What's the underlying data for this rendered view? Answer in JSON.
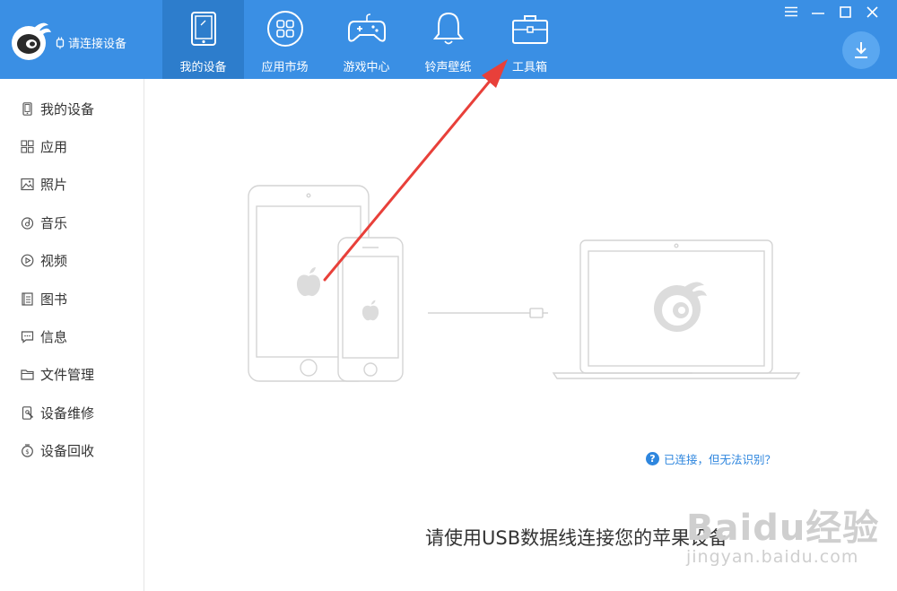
{
  "header": {
    "connection_status": "请连接设备",
    "tabs": [
      {
        "label": "我的设备",
        "icon": "tablet-icon",
        "active": true
      },
      {
        "label": "应用市场",
        "icon": "app-grid-icon",
        "active": false
      },
      {
        "label": "游戏中心",
        "icon": "gamepad-icon",
        "active": false
      },
      {
        "label": "铃声壁纸",
        "icon": "bell-icon",
        "active": false
      },
      {
        "label": "工具箱",
        "icon": "toolbox-icon",
        "active": false
      }
    ],
    "window_controls": [
      "menu-icon",
      "minimize-icon",
      "maximize-icon",
      "close-icon"
    ],
    "download_icon": "download-icon"
  },
  "sidebar": {
    "items": [
      {
        "label": "我的设备",
        "icon": "phone-icon"
      },
      {
        "label": "应用",
        "icon": "apps-icon"
      },
      {
        "label": "照片",
        "icon": "photo-icon"
      },
      {
        "label": "音乐",
        "icon": "music-icon"
      },
      {
        "label": "视频",
        "icon": "video-icon"
      },
      {
        "label": "图书",
        "icon": "book-icon"
      },
      {
        "label": "信息",
        "icon": "message-icon"
      },
      {
        "label": "文件管理",
        "icon": "folder-icon"
      },
      {
        "label": "设备维修",
        "icon": "repair-icon"
      },
      {
        "label": "设备回收",
        "icon": "recycle-icon"
      }
    ]
  },
  "main": {
    "connect_prompt": "请使用USB数据线连接您的苹果设备",
    "help_link": "已连接，但无法识别？",
    "help_icon": "?"
  },
  "watermark": {
    "brand": "Baidu经验",
    "url": "jingyan.baidu.com"
  },
  "colors": {
    "header_bg": "#3a8fe4",
    "active_tab_bg": "#2d7dcc",
    "link": "#2e86de",
    "annotation_arrow": "#e8403a"
  }
}
